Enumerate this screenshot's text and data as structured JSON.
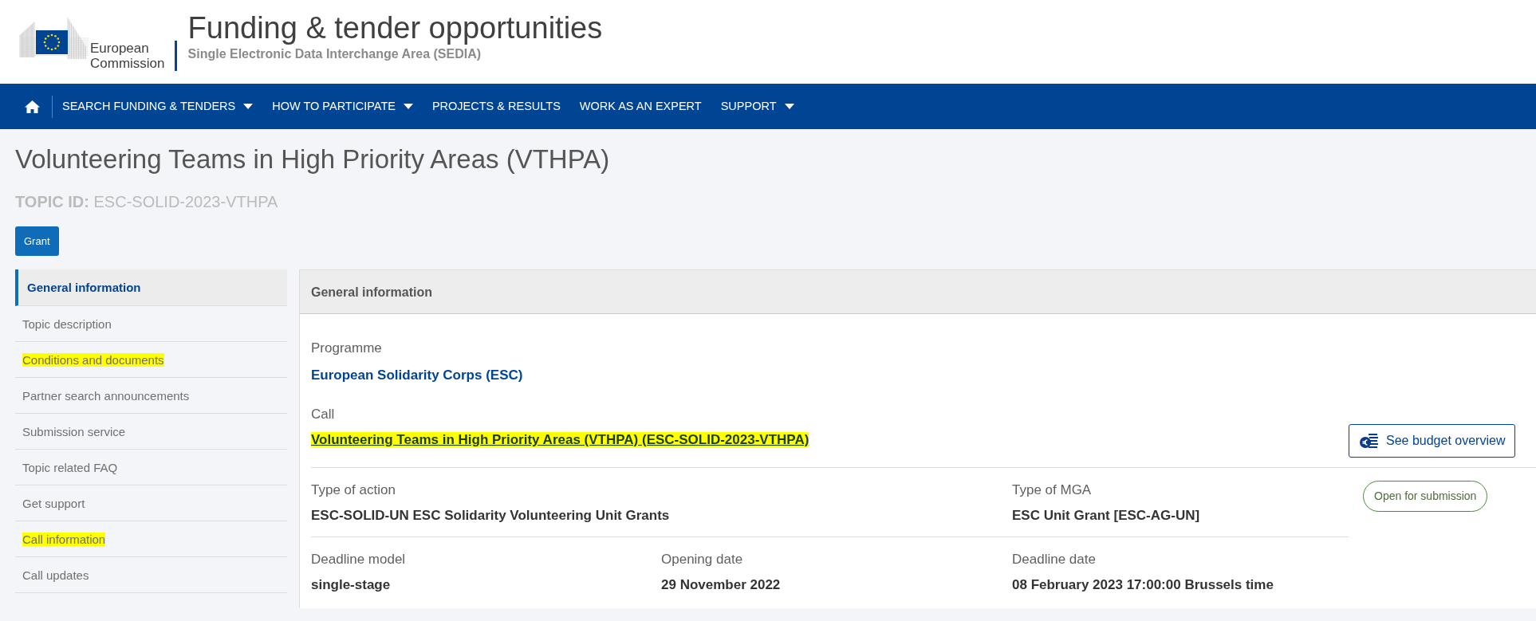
{
  "header": {
    "logo_text": [
      "European",
      "Commission"
    ],
    "title": "Funding & tender opportunities",
    "subtitle": "Single Electronic Data Interchange Area (SEDIA)"
  },
  "nav": {
    "items": [
      {
        "label": "SEARCH FUNDING & TENDERS",
        "dropdown": true
      },
      {
        "label": "HOW TO PARTICIPATE",
        "dropdown": true
      },
      {
        "label": "PROJECTS & RESULTS",
        "dropdown": false
      },
      {
        "label": "WORK AS AN EXPERT",
        "dropdown": false
      },
      {
        "label": "SUPPORT",
        "dropdown": true
      }
    ]
  },
  "page": {
    "title": "Volunteering Teams in High Priority Areas (VTHPA)",
    "topic_id_label": "TOPIC ID:",
    "topic_id": "ESC-SOLID-2023-VTHPA",
    "type_badge": "Grant"
  },
  "sidebar": {
    "items": [
      {
        "label": "General information",
        "selected": true,
        "highlighted": false
      },
      {
        "label": "Topic description",
        "selected": false,
        "highlighted": false
      },
      {
        "label": "Conditions and documents",
        "selected": false,
        "highlighted": true
      },
      {
        "label": "Partner search announcements",
        "selected": false,
        "highlighted": false
      },
      {
        "label": "Submission service",
        "selected": false,
        "highlighted": false
      },
      {
        "label": "Topic related FAQ",
        "selected": false,
        "highlighted": false
      },
      {
        "label": "Get support",
        "selected": false,
        "highlighted": false
      },
      {
        "label": "Call information",
        "selected": false,
        "highlighted": true
      },
      {
        "label": "Call updates",
        "selected": false,
        "highlighted": false
      }
    ]
  },
  "card": {
    "title": "General information",
    "programme": {
      "label": "Programme",
      "value": "European Solidarity Corps (ESC)"
    },
    "call": {
      "label": "Call",
      "value": "Volunteering Teams in High Priority Areas (VTHPA) (ESC-SOLID-2023-VTHPA)",
      "highlighted": true
    },
    "budget_button": "See budget overview",
    "status": "Open for submission",
    "rows": [
      [
        {
          "label": "Type of action",
          "value": "ESC-SOLID-UN ESC Solidarity Volunteering Unit Grants"
        },
        "",
        {
          "label": "Type of MGA",
          "value": "ESC Unit Grant [ESC-AG-UN]"
        }
      ],
      [
        {
          "label": "Deadline model",
          "value": "single-stage"
        },
        {
          "label": "Opening date",
          "value": "29 November 2022"
        },
        {
          "label": "Deadline date",
          "value": "08 February 2023 17:00:00 Brussels time"
        }
      ]
    ]
  }
}
